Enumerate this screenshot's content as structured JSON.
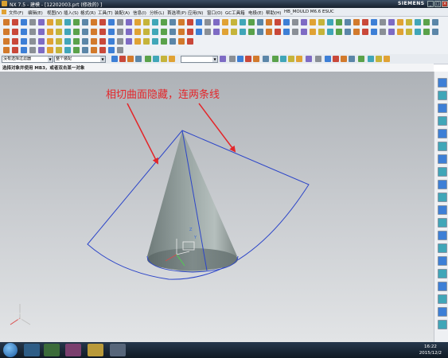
{
  "window": {
    "title": "NX 7.5 - 建模 - [12202003.prt (修改的) ]",
    "brand": "SIEMENS"
  },
  "menu": {
    "items": [
      "文件(F)",
      "编辑(E)",
      "视图(V)",
      "插入(S)",
      "格式(R)",
      "工具(T)",
      "装配(A)",
      "信息(I)",
      "分析(L)",
      "首选项(P)",
      "应用(N)",
      "窗口(O)",
      "GC工具箱",
      "电极(E)",
      "帮助(H)",
      "HB_MOULD M6.6",
      "ESUC"
    ]
  },
  "filterbar": {
    "filter_combo": "没有选择过滤器",
    "assembly_combo": "整个装配"
  },
  "status": {
    "prompt": "选择对象并使用 MB3，或者双击某一对象"
  },
  "annotation": {
    "text": "相切曲面隐藏，连两条线"
  },
  "viewport": {
    "background_top": "#aeb2b7",
    "background_bottom": "#e2e4e6",
    "cone_color": "#8e9a98",
    "sector_line_color": "#2c45c8",
    "arrow_color": "#e3262a"
  },
  "taskbar": {
    "time": "16:22",
    "date": "2015/12/2"
  }
}
